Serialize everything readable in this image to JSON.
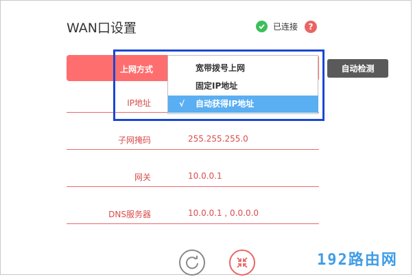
{
  "header": {
    "title": "WAN口设置",
    "status_text": "已连接",
    "help_glyph": "?"
  },
  "connection": {
    "mode_label": "上网方式",
    "auto_detect_label": "自动检测",
    "dropdown": {
      "options": [
        {
          "label": "宽带拨号上网",
          "selected": false
        },
        {
          "label": "固定IP地址",
          "selected": false
        },
        {
          "label": "自动获得IP地址",
          "selected": true
        }
      ],
      "check_glyph": "√"
    }
  },
  "fields": [
    {
      "label": "IP地址",
      "value": ""
    },
    {
      "label": "子网掩码",
      "value": "255.255.255.0"
    },
    {
      "label": "网关",
      "value": "10.0.0.1"
    },
    {
      "label": "DNS服务器",
      "value": "10.0.0.1 , 0.0.0.0"
    }
  ],
  "footer": {
    "refresh_icon": "refresh-icon",
    "collapse_icon": "collapse-icon"
  },
  "watermark": "192路由网",
  "colors": {
    "accent_red": "#ff6e6e",
    "selected_blue": "#5aaef2",
    "highlight_border": "#1a46d4",
    "status_green": "#3bbf5a"
  }
}
